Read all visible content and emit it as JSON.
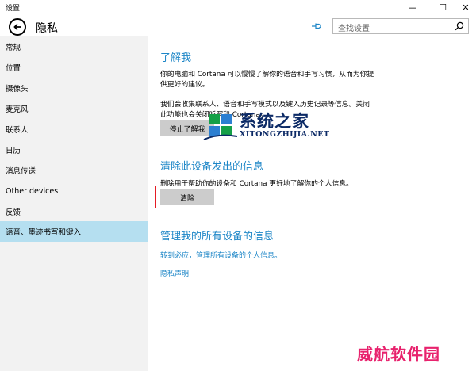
{
  "window": {
    "title": "设置",
    "minimize": "—",
    "maximize": "☐",
    "close": "✕"
  },
  "header": {
    "page_title": "隐私",
    "search": {
      "placeholder": "查找设置"
    }
  },
  "sidebar": {
    "items": [
      {
        "label": "常规",
        "active": false
      },
      {
        "label": "位置",
        "active": false
      },
      {
        "label": "摄像头",
        "active": false
      },
      {
        "label": "麦克风",
        "active": false
      },
      {
        "label": "联系人",
        "active": false
      },
      {
        "label": "日历",
        "active": false
      },
      {
        "label": "消息传送",
        "active": false
      },
      {
        "label": "Other devices",
        "active": false
      },
      {
        "label": "反馈",
        "active": false
      },
      {
        "label": "语音、墨迹书写和键入",
        "active": true
      }
    ]
  },
  "main": {
    "getting_to_know_you": {
      "title": "了解我",
      "para1": "你的电脑和 Cortana 可以慢慢了解你的语音和手写习惯，从而为你提供更好的建议。",
      "para2": "我们会收集联系人、语音和手写模式以及键入历史记录等信息。关闭此功能也会关闭听写和 Cortana。",
      "button": "停止了解我"
    },
    "clear_device": {
      "title": "清除此设备发出的信息",
      "para": "删除用于帮助你的设备和 Cortana 更好地了解你的个人信息。",
      "button": "清除"
    },
    "manage_all": {
      "title": "管理我的所有设备的信息",
      "link1": "转到必应，管理所有设备的个人信息。",
      "link2": "隐私声明"
    }
  },
  "watermarks": {
    "logo_text": "系统之家",
    "logo_domain": "XITONGZHIJIA.NET",
    "corner_text": "威航软件园"
  },
  "colors": {
    "accent": "#1d86c7",
    "sidebar_bg": "#f2f2f2",
    "sidebar_active": "#b5dff0",
    "button_bg": "#cccccc",
    "highlight": "#e51b24",
    "watermark_pink": "#e8226d",
    "watermark_navy": "#0c2a66"
  }
}
